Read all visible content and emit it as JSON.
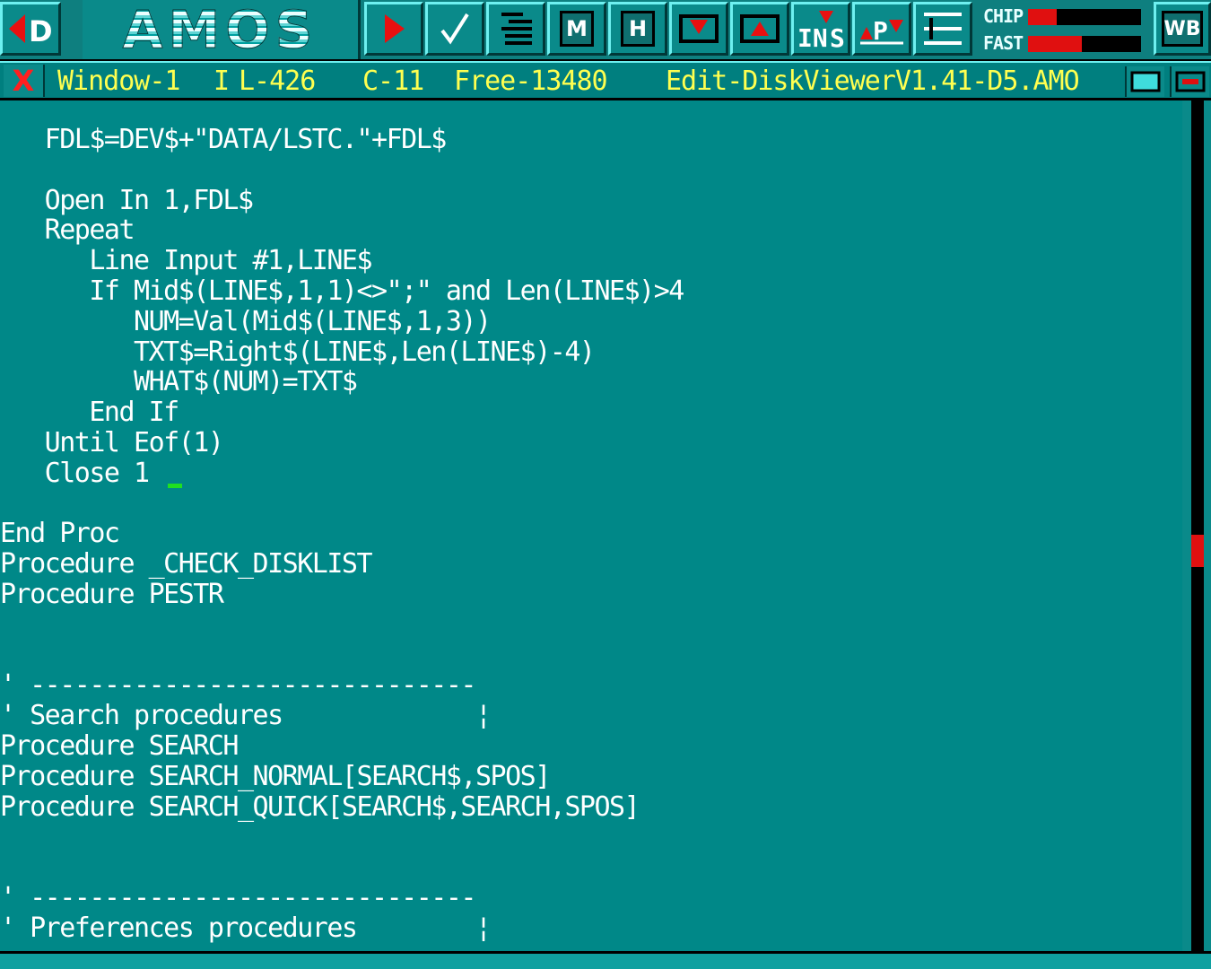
{
  "toolbar": {
    "logo_text": "AMOS",
    "buttons": [
      {
        "name": "prev-menu-button",
        "icon": "arrow-left-d-icon"
      },
      {
        "name": "run-button",
        "icon": "play-icon"
      },
      {
        "name": "test-button",
        "icon": "check-icon"
      },
      {
        "name": "indent-button",
        "icon": "lines-icon"
      },
      {
        "name": "monitor-button",
        "icon": "m-key-icon",
        "label": "M"
      },
      {
        "name": "help-button",
        "icon": "h-key-icon",
        "label": "H"
      },
      {
        "name": "fold-button",
        "icon": "fold-down-icon"
      },
      {
        "name": "unfold-button",
        "icon": "fold-up-icon"
      },
      {
        "name": "insert-button",
        "icon": "insert-icon",
        "label": "IN S"
      },
      {
        "name": "procedure-button",
        "icon": "procedure-icon",
        "label": "P"
      },
      {
        "name": "line-button",
        "icon": "line-insert-icon"
      },
      {
        "name": "workbench-button",
        "icon": "wb-icon",
        "label": "WB"
      }
    ],
    "memory": {
      "chip_label": "CHIP",
      "fast_label": "FAST",
      "chip_fraction": 0.25,
      "fast_fraction": 0.48
    }
  },
  "status": {
    "close_label": "X",
    "window": "Window-1",
    "insert_mode": "I",
    "line": "L-426",
    "column": "C-11",
    "free": "Free-13480",
    "edit_file": "Edit-DiskViewerV1.41-D5.AMO"
  },
  "editor": {
    "lines": [
      "   FDL$=DEV$+\"DATA/LSTC.\"+FDL$",
      "",
      "   Open In 1,FDL$",
      "   Repeat",
      "      Line Input #1,LINE$",
      "      If Mid$(LINE$,1,1)<>\";\" and Len(LINE$)>4",
      "         NUM=Val(Mid$(LINE$,1,3))",
      "         TXT$=Right$(LINE$,Len(LINE$)-4)",
      "         WHAT$(NUM)=TXT$",
      "      End If",
      "   Until Eof(1)",
      "   Close 1",
      "",
      "End Proc",
      "Procedure _CHECK_DISKLIST",
      "Procedure PESTR",
      "",
      "",
      "' ------------------------------",
      "' Search procedures             ¦",
      "Procedure SEARCH",
      "Procedure SEARCH_NORMAL[SEARCH$,SPOS]",
      "Procedure SEARCH_QUICK[SEARCH$,SEARCH,SPOS]",
      "",
      "",
      "' ------------------------------",
      "' Preferences procedures        ¦"
    ],
    "cursor_line": 11,
    "cursor_col": 11
  },
  "scrollbar": {
    "position_fraction": 0.53
  },
  "colors": {
    "background": "#008888",
    "status_text": "#ffff50",
    "code_text": "#ffffff",
    "cursor": "#20e020",
    "memory_bar": "#e01010"
  }
}
